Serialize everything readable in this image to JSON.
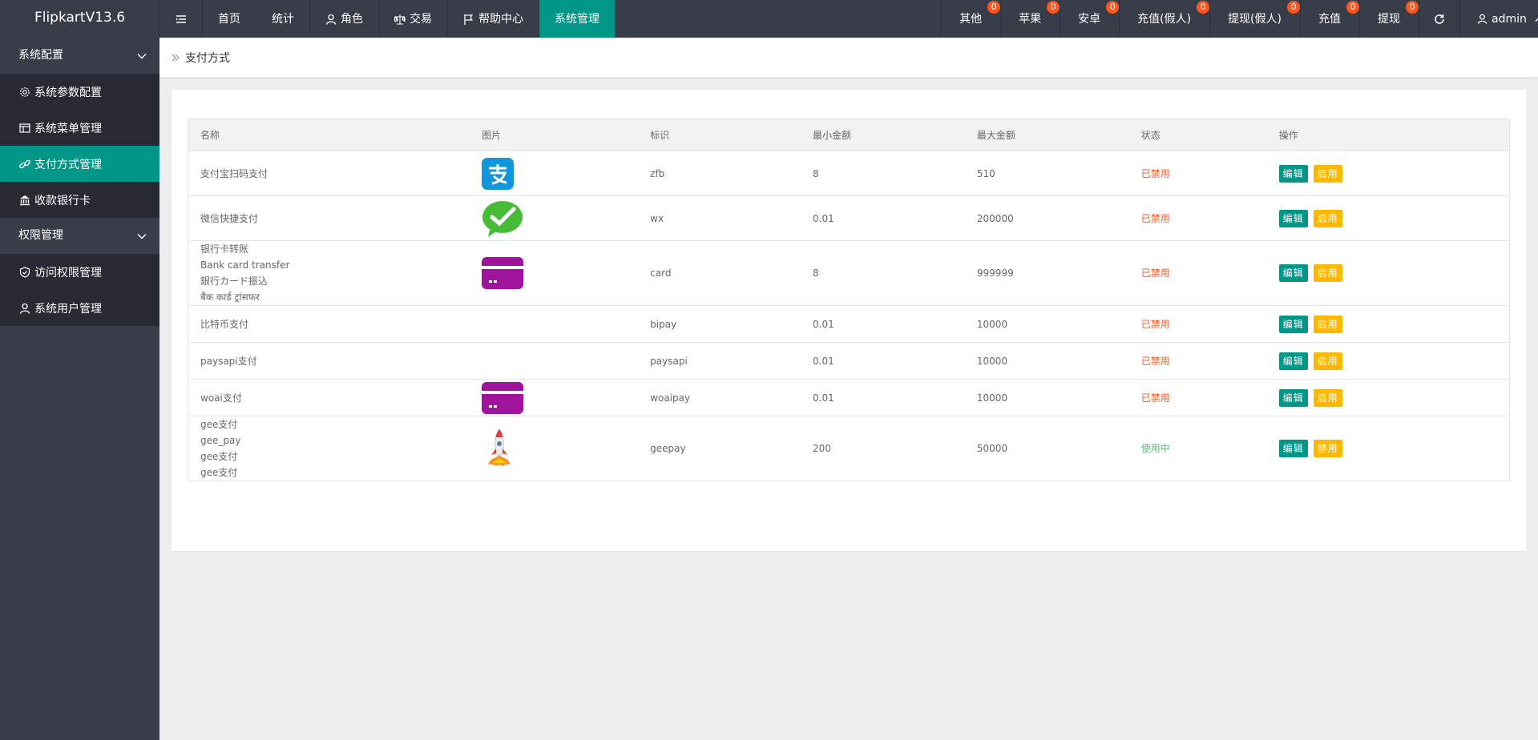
{
  "header": {
    "logo": "FlipkartV13.6",
    "left_nav": [
      {
        "label": "首页",
        "icon": ""
      },
      {
        "label": "统计",
        "icon": ""
      },
      {
        "label": "角色",
        "icon": "user-icon"
      },
      {
        "label": "交易",
        "icon": "balance-icon"
      },
      {
        "label": "帮助中心",
        "icon": "flag-icon"
      },
      {
        "label": "系统管理",
        "icon": "",
        "active": true
      }
    ],
    "right_nav": [
      {
        "label": "其他",
        "badge": "0"
      },
      {
        "label": "苹果",
        "badge": "0"
      },
      {
        "label": "安卓",
        "badge": "0"
      },
      {
        "label": "充值(假人)",
        "badge": "0"
      },
      {
        "label": "提现(假人)",
        "badge": "0"
      },
      {
        "label": "充值",
        "badge": "0"
      },
      {
        "label": "提现",
        "badge": "0"
      }
    ],
    "user": "admin",
    "colors": {
      "bg": "#393d49",
      "active": "#009688",
      "badge": "#ff5722"
    }
  },
  "sidebar": {
    "groups": [
      {
        "label": "系统配置",
        "items": [
          {
            "label": "系统参数配置",
            "icon": "gear-icon"
          },
          {
            "label": "系统菜单管理",
            "icon": "window-icon"
          },
          {
            "label": "支付方式管理",
            "icon": "link-icon",
            "active": true
          },
          {
            "label": "收款银行卡",
            "icon": "bank-icon"
          }
        ]
      },
      {
        "label": "权限管理",
        "items": [
          {
            "label": "访问权限管理",
            "icon": "shield-icon"
          },
          {
            "label": "系统用户管理",
            "icon": "user-icon"
          }
        ]
      }
    ]
  },
  "breadcrumb": {
    "label": "支付方式"
  },
  "table": {
    "columns": [
      "名称",
      "图片",
      "标识",
      "最小金额",
      "最大金额",
      "状态",
      "操作"
    ],
    "rows": [
      {
        "name": [
          "支付宝扫码支付"
        ],
        "pic": "alipay",
        "code": "zfb",
        "min": "8",
        "max": "510",
        "status": "已禁用",
        "enabled": false,
        "edit": "编辑",
        "toggle": "启用"
      },
      {
        "name": [
          "微信快捷支付"
        ],
        "pic": "wechat",
        "code": "wx",
        "min": "0.01",
        "max": "200000",
        "status": "已禁用",
        "enabled": false,
        "edit": "编辑",
        "toggle": "启用"
      },
      {
        "name": [
          "银行卡转账",
          "Bank card transfer",
          "銀行カード振込",
          "बैंक कार्ड ट्रांसफर"
        ],
        "pic": "card",
        "code": "card",
        "min": "8",
        "max": "999999",
        "status": "已禁用",
        "enabled": false,
        "edit": "编辑",
        "toggle": "启用"
      },
      {
        "name": [
          "比特币支付"
        ],
        "pic": "",
        "code": "bipay",
        "min": "0.01",
        "max": "10000",
        "status": "已禁用",
        "enabled": false,
        "edit": "编辑",
        "toggle": "启用"
      },
      {
        "name": [
          "paysapi支付"
        ],
        "pic": "",
        "code": "paysapi",
        "min": "0.01",
        "max": "10000",
        "status": "已禁用",
        "enabled": false,
        "edit": "编辑",
        "toggle": "启用"
      },
      {
        "name": [
          "woai支付"
        ],
        "pic": "card",
        "code": "woaipay",
        "min": "0.01",
        "max": "10000",
        "status": "已禁用",
        "enabled": false,
        "edit": "编辑",
        "toggle": "启用"
      },
      {
        "name": [
          "gee支付",
          "gee_pay",
          "gee支付",
          "gee支付"
        ],
        "pic": "rocket",
        "code": "geepay",
        "min": "200",
        "max": "50000",
        "status": "使用中",
        "enabled": true,
        "edit": "编辑",
        "toggle": "禁用"
      }
    ]
  }
}
